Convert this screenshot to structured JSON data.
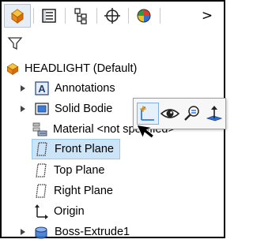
{
  "tabs": [
    {
      "name": "feature-manager-tab",
      "icon": "feature-manager-icon",
      "active": true
    },
    {
      "name": "property-manager-tab",
      "icon": "property-manager-icon",
      "active": false
    },
    {
      "name": "configuration-manager-tab",
      "icon": "configuration-manager-icon",
      "active": false
    },
    {
      "name": "dimxpert-manager-tab",
      "icon": "dimxpert-icon",
      "active": false
    },
    {
      "name": "display-manager-tab",
      "icon": "display-manager-icon",
      "active": false
    }
  ],
  "tab_more_label": ">",
  "filter_icon": "filter-icon",
  "tree": {
    "root": {
      "label": "HEADLIGHT  (Default)",
      "icon": "part-icon"
    },
    "items": [
      {
        "label": "Annotations",
        "icon": "annotations-icon",
        "expandable": true
      },
      {
        "label": "Solid Bodie",
        "icon": "solid-bodies-icon",
        "expandable": true
      },
      {
        "label": "Material <not specified>",
        "icon": "material-icon",
        "expandable": false
      },
      {
        "label": "Front Plane",
        "icon": "plane-icon",
        "expandable": false,
        "selected": true
      },
      {
        "label": "Top Plane",
        "icon": "plane-icon",
        "expandable": false
      },
      {
        "label": "Right Plane",
        "icon": "plane-icon",
        "expandable": false
      },
      {
        "label": "Origin",
        "icon": "origin-icon",
        "expandable": false
      },
      {
        "label": "Boss-Extrude1",
        "icon": "boss-extrude-icon",
        "expandable": true
      }
    ]
  },
  "context_toolbar": {
    "buttons": [
      {
        "name": "sketch-button",
        "icon": "sketch-icon"
      },
      {
        "name": "hide-show-button",
        "icon": "eye-icon"
      },
      {
        "name": "zoom-to-selection-button",
        "icon": "zoom-to-selection-icon"
      },
      {
        "name": "normal-to-button",
        "icon": "normal-to-icon"
      }
    ]
  },
  "colors": {
    "selection_bg": "#cce4f7",
    "selection_border": "#99c9ef",
    "accent_blue": "#1f6fd1",
    "part_yellow": "#f2b400",
    "part_orange": "#e8731a"
  }
}
